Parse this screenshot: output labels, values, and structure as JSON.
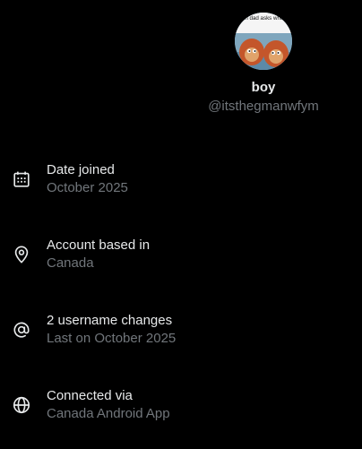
{
  "profile": {
    "avatar_caption": "when dad asks who farted in the car",
    "display_name": "boy",
    "handle": "@itsthegmanwfym"
  },
  "about": {
    "items": [
      {
        "icon": "calendar-icon",
        "title": "Date joined",
        "subtitle": "October 2025"
      },
      {
        "icon": "location-pin-icon",
        "title": "Account based in",
        "subtitle": "Canada"
      },
      {
        "icon": "at-sign-icon",
        "title": "2 username changes",
        "subtitle": "Last on October 2025"
      },
      {
        "icon": "globe-icon",
        "title": "Connected via",
        "subtitle": "Canada Android App"
      }
    ]
  },
  "colors": {
    "background": "#000000",
    "primary_text": "#e7e9ea",
    "secondary_text": "#71767b"
  }
}
